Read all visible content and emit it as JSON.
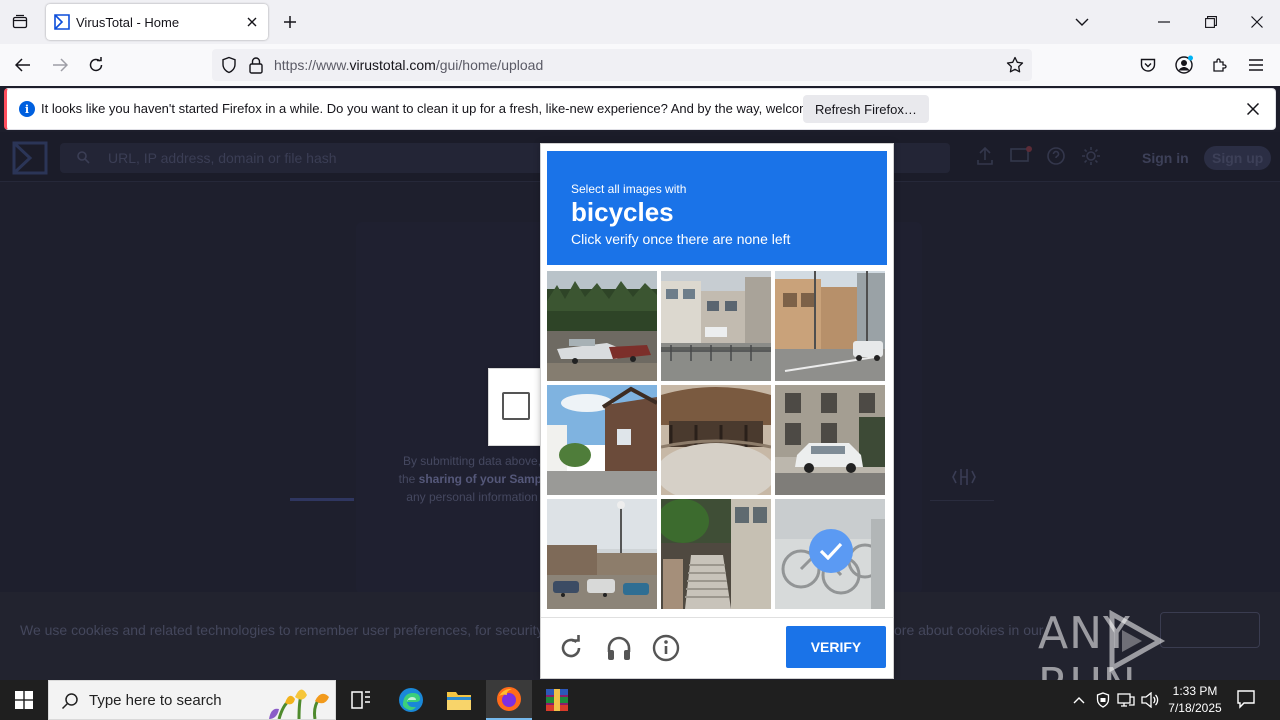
{
  "browser": {
    "tab_title": "VirusTotal - Home",
    "url_prefix": "https://www.",
    "url_domain": "virustotal.com",
    "url_path": "/gui/home/upload",
    "infobar_message": "It looks like you haven't started Firefox in a while. Do you want to clean it up for a fresh, like-new experience? And by the way, welcome back!",
    "refresh_button": "Refresh Firefox…"
  },
  "vt": {
    "search_placeholder": "URL, IP address, domain or file hash",
    "sign_in": "Sign in",
    "sign_up": "Sign up",
    "terms_line1": "By submitting data above,",
    "terms_line2_prefix": "the ",
    "terms_line2_bold": "sharing of your Sampl",
    "terms_line3": "any personal information",
    "cookie_text_left": "We use cookies and related technologies to remember user preferences, for security, to a",
    "cookie_text_right": "ore about cookies in our"
  },
  "captcha": {
    "prompt": "Select all images with",
    "target": "bicycles",
    "instruction": "Click verify once there are none left",
    "verify_label": "VERIFY",
    "tiles": [
      {
        "id": 1,
        "selected": false
      },
      {
        "id": 2,
        "selected": false
      },
      {
        "id": 3,
        "selected": false
      },
      {
        "id": 4,
        "selected": false
      },
      {
        "id": 5,
        "selected": false
      },
      {
        "id": 6,
        "selected": false
      },
      {
        "id": 7,
        "selected": false
      },
      {
        "id": 8,
        "selected": false
      },
      {
        "id": 9,
        "selected": true
      }
    ]
  },
  "watermark": "ANY RUN",
  "taskbar": {
    "search_placeholder": "Type here to search",
    "time": "1:33 PM",
    "date": "7/18/2025"
  },
  "colors": {
    "captcha_blue": "#1a73e8",
    "firefox_accent": "#0060df",
    "infobar_accent": "#ff4f5e"
  }
}
